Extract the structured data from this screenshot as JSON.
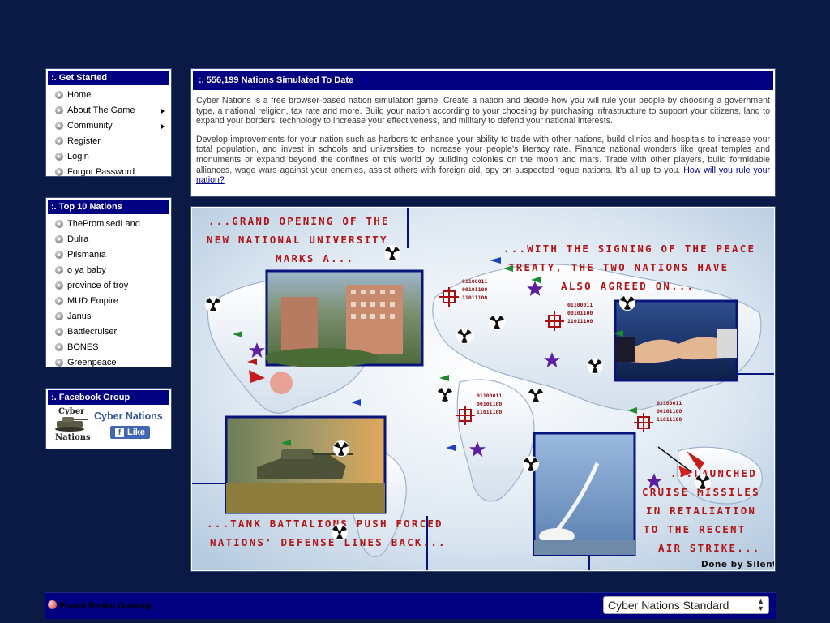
{
  "get_started": {
    "title": ":. Get Started",
    "items": [
      {
        "label": "Home",
        "submenu": false
      },
      {
        "label": "About The Game",
        "submenu": true
      },
      {
        "label": "Community",
        "submenu": true
      },
      {
        "label": "Register",
        "submenu": false
      },
      {
        "label": "Login",
        "submenu": false
      },
      {
        "label": "Forgot Password",
        "submenu": false
      }
    ]
  },
  "top10": {
    "title": ":. Top 10 Nations",
    "items": [
      "ThePromisedLand",
      "Dulra",
      "Pilsmania",
      "o ya baby",
      "province of troy",
      "MUD Empire",
      "Janus",
      "Battlecruiser",
      "BONES",
      "Greenpeace"
    ]
  },
  "facebook": {
    "title": ":. Facebook Group",
    "logo_text_1": "Cyber",
    "logo_text_2": "Nations",
    "group_name": "Cyber Nations",
    "like_label": "Like"
  },
  "main": {
    "title": ":. 556,199 Nations Simulated To Date",
    "paragraph1": "Cyber Nations is a free browser-based nation simulation game. Create a nation and decide how you will rule your people by choosing a government type, a national religion, tax rate and more. Build your nation according to your choosing by purchasing infrastructure to support your citizens, land to expand your borders, technology to increase your effectiveness, and military to defend your national interests.",
    "paragraph2": "Develop improvements for your nation such as harbors to enhance your ability to trade with other nations, build clinics and hospitals to increase your total population, and invest in schools and universities to increase your people's literacy rate. Finance national wonders like great temples and monuments or expand beyond the confines of this world by building colonies on the moon and mars. Trade with other players, build formidable alliances, wage wars against your enemies, assist others with foreign aid, spy on suspected rogue nations. It's all up to you.",
    "link_text": "How will you rule your nation?"
  },
  "banner": {
    "caption_university": [
      "...GRAND OPENING OF THE",
      "NEW NATIONAL UNIVERSITY",
      "MARKS A..."
    ],
    "caption_treaty": [
      "...WITH THE SIGNING OF THE PEACE",
      "TREATY, THE TWO NATIONS HAVE",
      "ALSO AGREED ON..."
    ],
    "caption_tanks": [
      "...TANK BATTALIONS PUSH FORCED",
      "NATIONS' DEFENSE LINES BACK..."
    ],
    "caption_missiles": [
      "...LAUNCHED",
      "CRUISE MISSILES",
      "IN RETALIATION",
      "TO THE RECENT",
      "AIR STRIKE..."
    ],
    "binary": [
      "01100011",
      "00101100",
      "11011100"
    ],
    "credit": "Done by Silent"
  },
  "footer": {
    "brand": "Planet Realm Gaming",
    "style_select": "Cyber Nations Standard"
  },
  "colors": {
    "page_bg": "#0a1a45",
    "header_bg": "#000080",
    "caption_red": "#b01515"
  }
}
